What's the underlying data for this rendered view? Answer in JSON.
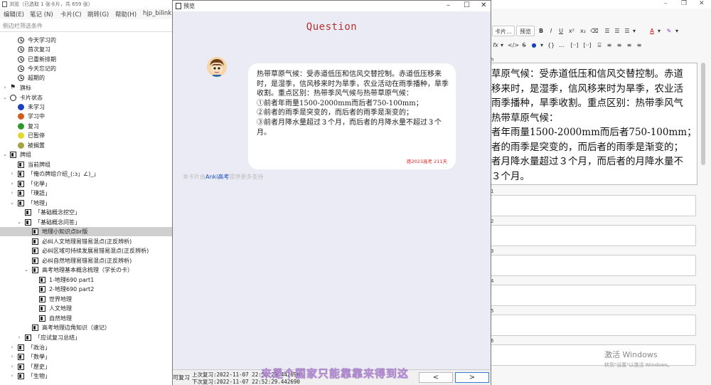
{
  "browser": {
    "title": "浏览（已选取 1 张卡片，共 659 张）",
    "menu": [
      "编辑(E)",
      "笔记 (N)",
      "卡片(C)",
      "跳转(G)",
      "帮助(H)",
      "hjp_bilink"
    ],
    "search_placeholder": "侧边栏筛选条件"
  },
  "sidebar": {
    "today": [
      "今天学习的",
      "首次复习",
      "已重新排期",
      "今天忘记的",
      "超期的"
    ],
    "flags_label": "旗标",
    "card_state": {
      "label": "卡片状态",
      "items": [
        {
          "label": "未学习",
          "color": "#1a3fbf"
        },
        {
          "label": "学习中",
          "color": "#d65a1a"
        },
        {
          "label": "复习",
          "color": "#2a9a2a"
        },
        {
          "label": "已暂停",
          "color": "#e6d82a"
        },
        {
          "label": "被搁置",
          "color": "#a4a440"
        }
      ]
    },
    "decks_label": "牌组",
    "current_deck": "当前牌组",
    "decks": [
      "「俺の牌组介绍_(:з」∠)_」",
      "「化學」",
      "「璞語」",
      "「地理」",
      "「基础概念挖空」",
      "「基础概念问答」",
      "地理小知识点br版",
      "必纠人文地理易错易混点(正反辨析)",
      "必纠区域可持续发展易错易混点(正反辨析)",
      "必纠自然地理易错易混点(正反辨析)",
      "高考地理基本概念梳理（学长の卡）",
      "1-地理690 part1",
      "2-地理690 part2",
      "世界地理",
      "人文地理",
      "自然地理",
      "高考地理边角知识（速记）",
      "「应试复习总结」",
      "「政治」",
      "「数學」",
      "「歷史」",
      "「生物」"
    ]
  },
  "preview": {
    "title": "预览",
    "heading": "Question",
    "question_lines": [
      "热带草原气候：受赤道低压和信风交替控制。赤道低压移来时，是湿季，信风移来时为旱季，农业活动在雨季播种，旱季收割。重点区别：热带季风气候与热带草原气候：",
      "①前者年雨量1500-2000mm而后者750-100mm；",
      "②前者的雨季是突变的，而后者的雨季是渐变的；",
      "③前者月降水量超过３个月，而后者的月降水量不超过３个月。"
    ],
    "countdown": "距2023高考 211天",
    "hint_prefix": "本卡片由",
    "hint_link": "Anki高考",
    "hint_suffix": "提供更多支持",
    "bottom_left": "可复习",
    "last_review": "上次复习:2022-11-07 22:52:29.442690",
    "next_review": "下次复习:2022-11-07 22:52:29.442690",
    "prev_label": "<",
    "next_label": ">"
  },
  "editor": {
    "toolbar1": [
      "卡片...",
      "预览",
      "B",
      "I",
      "U",
      "x²",
      "x₂",
      "⌫",
      "☰",
      "☰",
      "☰",
      "▾",
      "A",
      "▾",
      "✎",
      "▾"
    ],
    "toolbar2": [
      "fx",
      "▾",
      "</>",
      "S",
      "●",
      "▾",
      "{}",
      "…",
      "[··]",
      "[··]",
      "⌸",
      "≡",
      "≡",
      "≡",
      "≡"
    ],
    "front_label": "h",
    "front_lines": [
      "草原气候：受赤道低压和信风交替控制。赤道",
      "移来时，是湿季，信风移来时为旱季，农业活",
      "雨季播种，旱季收割。重点区别：热带季风气",
      "热带草原气候：",
      "者年雨量1500-2000mm而后者750-100mm；",
      "者的雨季是突变的，而后者的雨季是渐变的；",
      "者月降水量超过３个月，而后者的月降水量不",
      "３个月。"
    ],
    "field_labels": [
      "1",
      "2",
      "3",
      "4",
      "5",
      "6"
    ],
    "activate_title": "激活 Windows",
    "activate_sub": "转到\"设置\"以激活 Windows。"
  },
  "subtitle": "来是个国家只能靠靠来得到这",
  "colors": {
    "heading_red": "#b5332e",
    "preview_bg": "#ebebf5",
    "link_blue": "#1a4fbf"
  }
}
